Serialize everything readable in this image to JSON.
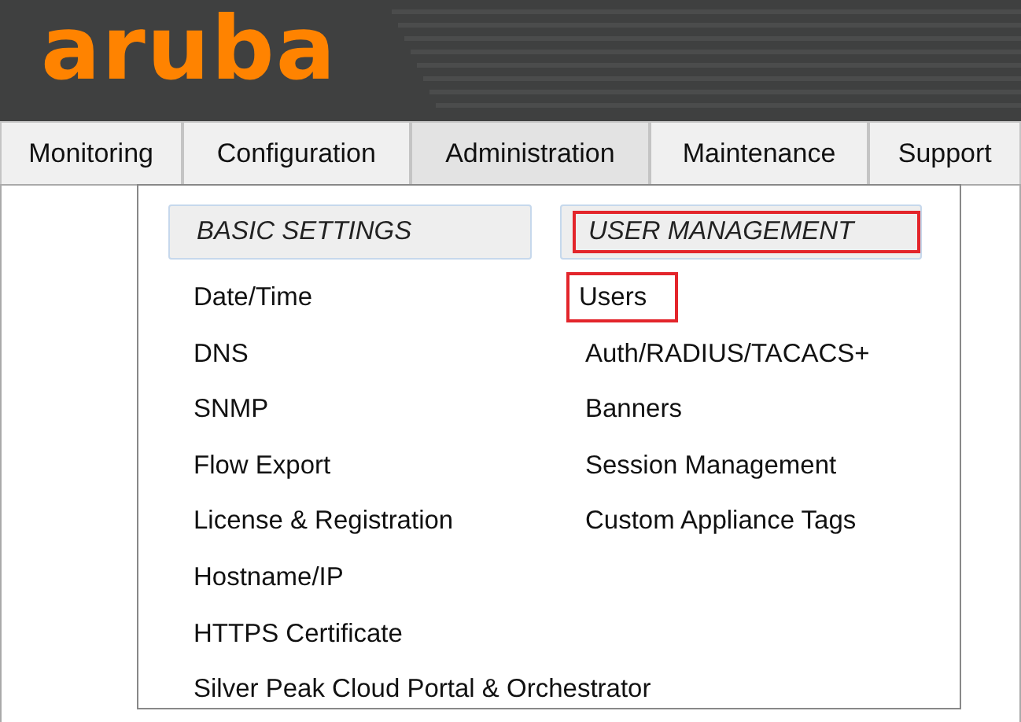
{
  "header": {
    "logo": "aruba"
  },
  "tabs": [
    {
      "label": "Monitoring",
      "selected": false
    },
    {
      "label": "Configuration",
      "selected": false
    },
    {
      "label": "Administration",
      "selected": true
    },
    {
      "label": "Maintenance",
      "selected": false
    },
    {
      "label": "Support",
      "selected": false
    }
  ],
  "dropdown": {
    "sections": [
      {
        "heading": "BASIC SETTINGS",
        "highlighted": false,
        "items": [
          {
            "label": "Date/Time",
            "highlighted": false
          },
          {
            "label": "DNS",
            "highlighted": false
          },
          {
            "label": "SNMP",
            "highlighted": false
          },
          {
            "label": "Flow Export",
            "highlighted": false
          },
          {
            "label": "License & Registration",
            "highlighted": false
          },
          {
            "label": "Hostname/IP",
            "highlighted": false
          },
          {
            "label": "HTTPS Certificate",
            "highlighted": false
          },
          {
            "label": "Silver Peak Cloud Portal & Orchestrator",
            "highlighted": false
          }
        ]
      },
      {
        "heading": "USER MANAGEMENT",
        "highlighted": true,
        "items": [
          {
            "label": "Users",
            "highlighted": true
          },
          {
            "label": "Auth/RADIUS/TACACS+",
            "highlighted": false
          },
          {
            "label": "Banners",
            "highlighted": false
          },
          {
            "label": "Session Management",
            "highlighted": false
          },
          {
            "label": "Custom Appliance Tags",
            "highlighted": false
          }
        ]
      }
    ]
  }
}
